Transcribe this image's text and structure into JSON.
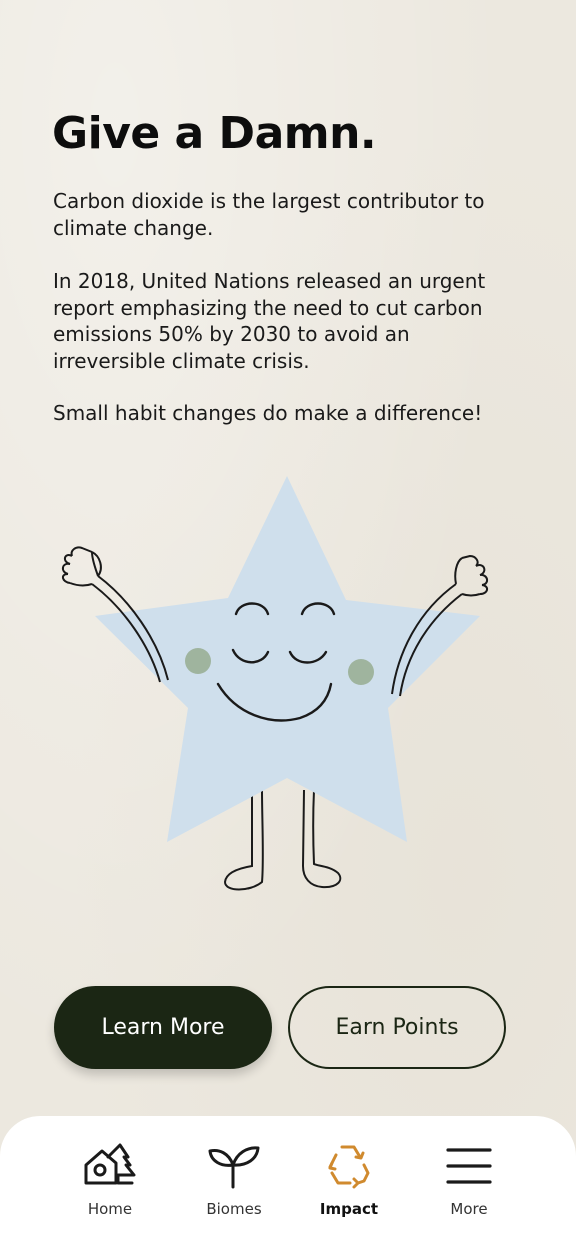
{
  "heading": "Give a Damn.",
  "paragraphs": [
    "Carbon dioxide is the largest contributor to climate change.",
    "In 2018, United Nations released an urgent report emphasizing the need to cut carbon emissions 50% by 2030 to avoid an irreversible climate crisis.",
    "Small habit changes do make a difference!"
  ],
  "buttons": {
    "learn_more": "Learn More",
    "earn_points": "Earn Points"
  },
  "nav": {
    "items": [
      {
        "label": "Home",
        "icon": "home-icon"
      },
      {
        "label": "Biomes",
        "icon": "sprout-icon"
      },
      {
        "label": "Impact",
        "icon": "recycle-icon",
        "active": true
      },
      {
        "label": "More",
        "icon": "menu-icon"
      }
    ]
  },
  "colors": {
    "background": "#ece8df",
    "primary_button": "#1b2614",
    "star": "#cfdfec",
    "cheeks": "#9fb49e",
    "active_icon": "#d08a2e"
  }
}
